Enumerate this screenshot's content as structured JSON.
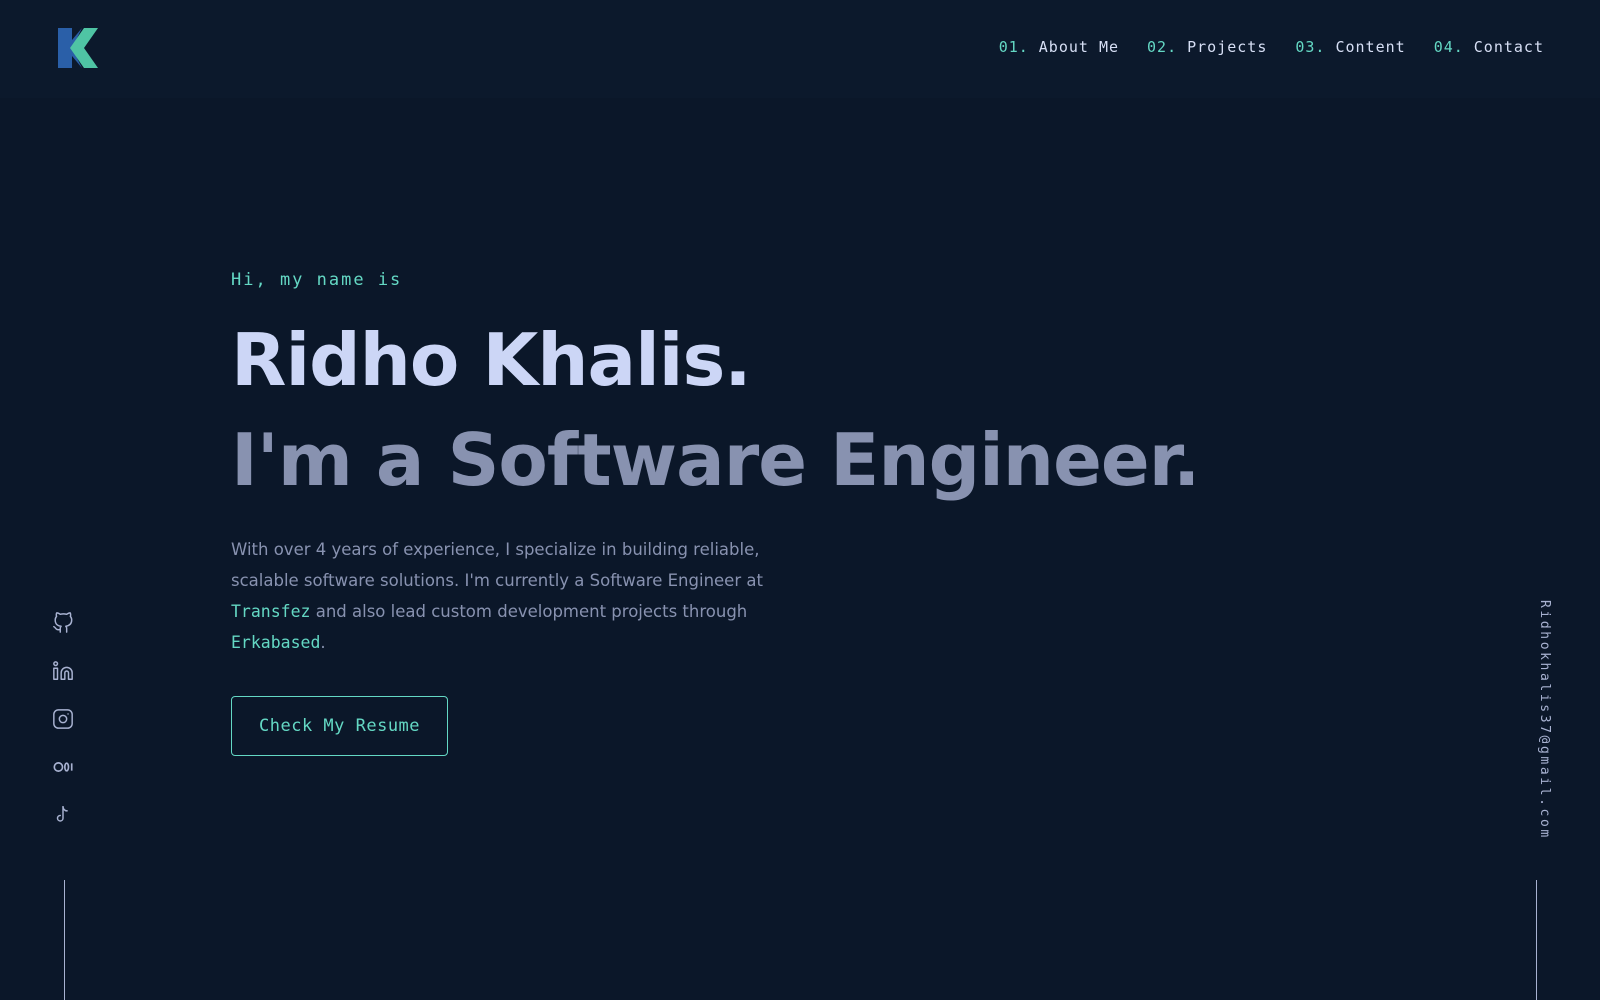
{
  "colors": {
    "background": "#0b1729",
    "accent": "#64d8c4",
    "heading": "#ccd6f6",
    "muted": "#8892b0",
    "logo_blue": "#2a5fa8"
  },
  "header": {
    "logo_icon": "k-logo-icon",
    "nav": [
      {
        "num": "01.",
        "label": "About Me"
      },
      {
        "num": "02.",
        "label": "Projects"
      },
      {
        "num": "03.",
        "label": "Content"
      },
      {
        "num": "04.",
        "label": "Contact"
      }
    ]
  },
  "hero": {
    "greeting": "Hi, my name is",
    "name": "Ridho Khalis.",
    "role": "I'm a Software Engineer.",
    "description": {
      "part1": "With over 4 years of experience, I specialize in building reliable, scalable software solutions. I'm currently a Software Engineer at ",
      "company1": "Transfez",
      "part2": " and also lead custom development projects through ",
      "company2": "Erkabased",
      "part3": "."
    },
    "resume_button": "Check My Resume"
  },
  "social": {
    "icons": [
      "github-icon",
      "linkedin-icon",
      "instagram-icon",
      "medium-icon",
      "tiktok-icon"
    ]
  },
  "email": "Ridhokhalis37@gmail.com"
}
